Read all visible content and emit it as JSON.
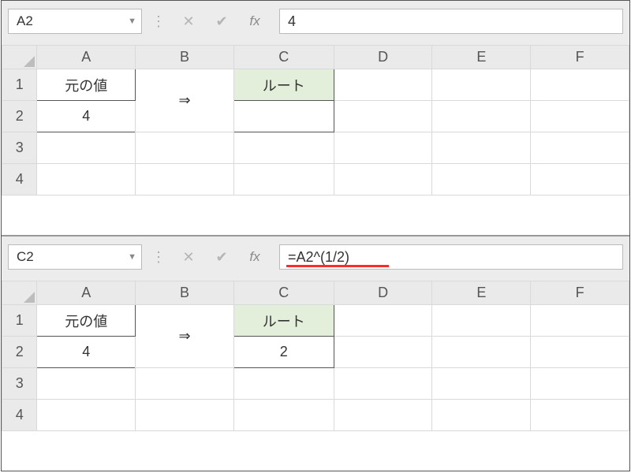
{
  "panes": [
    {
      "namebox": "A2",
      "formula": "4",
      "underline": false,
      "columns": [
        "A",
        "B",
        "C",
        "D",
        "E",
        "F"
      ],
      "rows": [
        "1",
        "2",
        "3",
        "4"
      ],
      "cells": {
        "A1": "元の値",
        "A2": "4",
        "B_arrow": "⇒",
        "C1": "ルート",
        "C2": ""
      }
    },
    {
      "namebox": "C2",
      "formula": "=A2^(1/2)",
      "underline": true,
      "columns": [
        "A",
        "B",
        "C",
        "D",
        "E",
        "F"
      ],
      "rows": [
        "1",
        "2",
        "3",
        "4"
      ],
      "cells": {
        "A1": "元の値",
        "A2": "4",
        "B_arrow": "⇒",
        "C1": "ルート",
        "C2": "2"
      }
    }
  ],
  "icons": {
    "cancel": "✕",
    "enter": "✔",
    "fx": "fx",
    "dropdown": "▼",
    "vdots": "⋮"
  }
}
